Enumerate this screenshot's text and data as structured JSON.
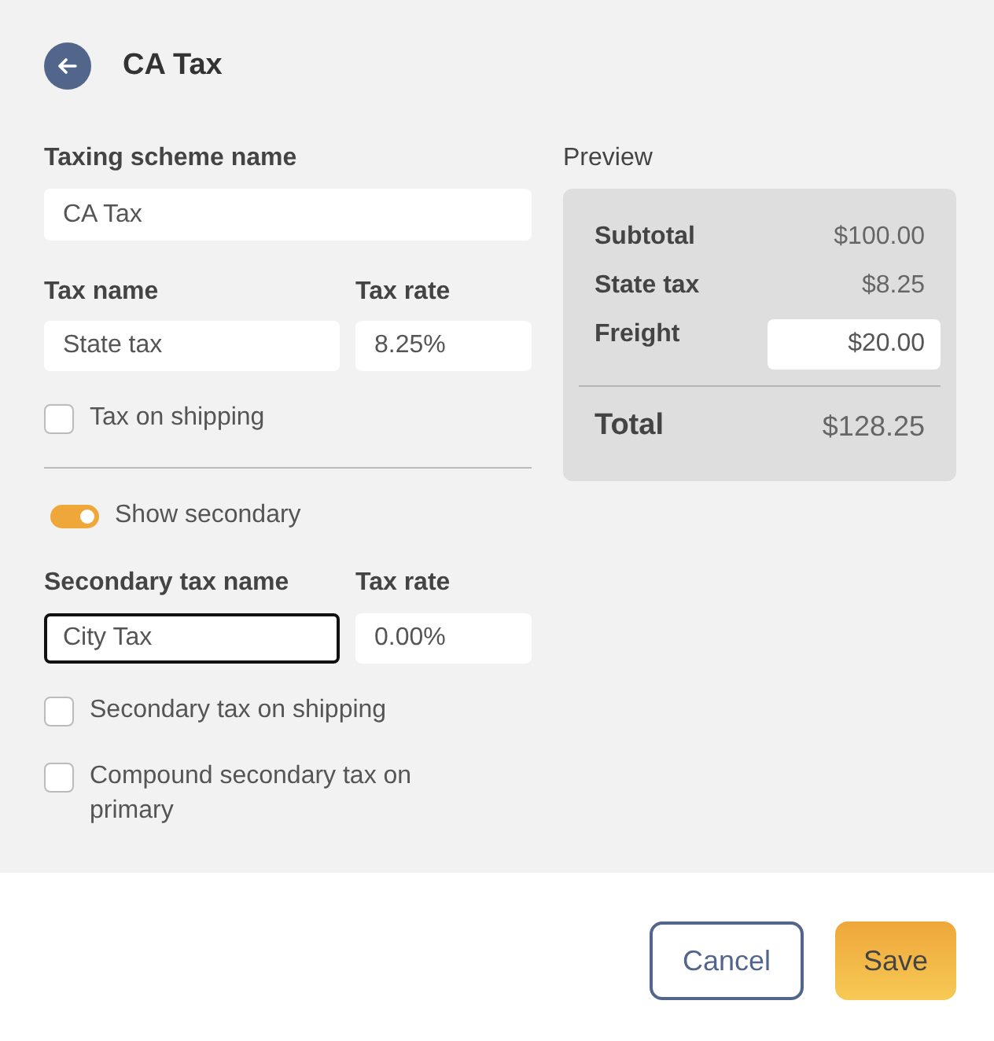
{
  "header": {
    "title": "CA Tax"
  },
  "scheme": {
    "label": "Taxing scheme name",
    "value": "CA Tax"
  },
  "primary": {
    "name_label": "Tax name",
    "name_value": "State tax",
    "rate_label": "Tax rate",
    "rate_value": "8.25%",
    "shipping": {
      "label": "Tax on shipping",
      "checked": false
    }
  },
  "secondary_toggle": {
    "label": "Show secondary",
    "on": true
  },
  "secondary": {
    "name_label": "Secondary tax name",
    "name_value": "City Tax",
    "name_focused": true,
    "rate_label": "Tax rate",
    "rate_value": "0.00%"
  },
  "options": [
    {
      "label": "Secondary tax on shipping",
      "checked": false
    },
    {
      "label": "Compound secondary tax on primary",
      "checked": false
    }
  ],
  "preview": {
    "title": "Preview",
    "rows": [
      {
        "kind": "text",
        "label": "Subtotal",
        "value": "$100.00"
      },
      {
        "kind": "text",
        "label": "State tax",
        "value": "$8.25"
      },
      {
        "kind": "input",
        "label": "Freight",
        "value": "$20.00"
      }
    ],
    "total": {
      "label": "Total",
      "value": "$128.25"
    }
  },
  "buttons": [
    {
      "kind": "secondary",
      "label": "Cancel"
    },
    {
      "kind": "primary",
      "label": "Save"
    }
  ]
}
